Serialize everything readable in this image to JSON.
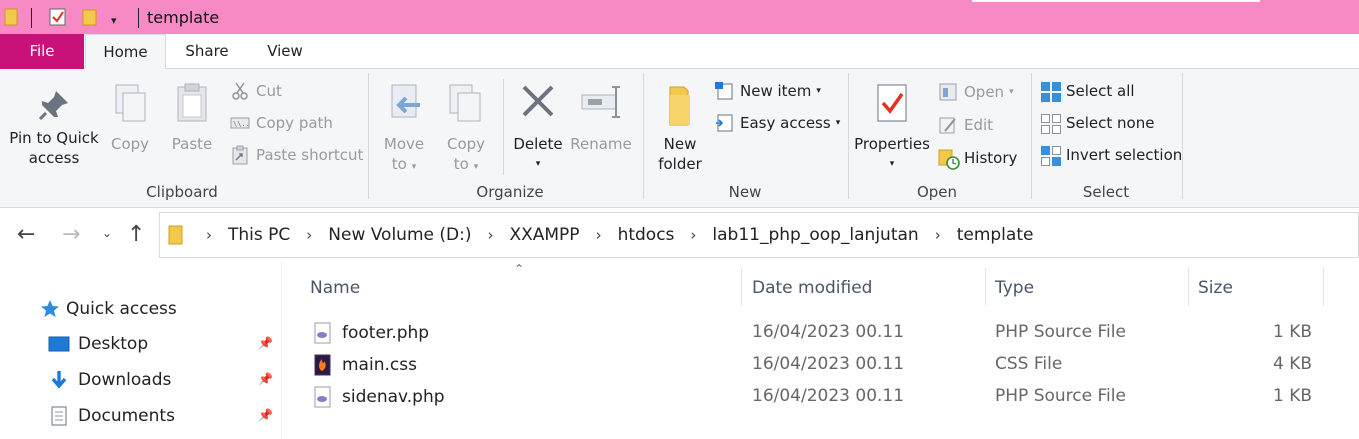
{
  "window": {
    "title": "template"
  },
  "ribbon_tabs": {
    "file": "File",
    "home": "Home",
    "share": "Share",
    "view": "View"
  },
  "clipboard": {
    "pin_line1": "Pin to Quick",
    "pin_line2": "access",
    "copy": "Copy",
    "paste": "Paste",
    "cut": "Cut",
    "copy_path": "Copy path",
    "paste_shortcut": "Paste shortcut",
    "group": "Clipboard"
  },
  "organize": {
    "move_line1": "Move",
    "move_line2": "to",
    "copy_line1": "Copy",
    "copy_line2": "to",
    "delete": "Delete",
    "rename": "Rename",
    "group": "Organize"
  },
  "new": {
    "folder_line1": "New",
    "folder_line2": "folder",
    "new_item": "New item",
    "easy_access": "Easy access",
    "group": "New"
  },
  "open": {
    "properties": "Properties",
    "open": "Open",
    "edit": "Edit",
    "history": "History",
    "group": "Open"
  },
  "select": {
    "select_all": "Select all",
    "select_none": "Select none",
    "invert": "Invert selection",
    "group": "Select"
  },
  "breadcrumb": [
    "This PC",
    "New Volume (D:)",
    "XXAMPP",
    "htdocs",
    "lab11_php_oop_lanjutan",
    "template"
  ],
  "nav": {
    "quick_access": "Quick access",
    "items": [
      {
        "label": "Desktop"
      },
      {
        "label": "Downloads"
      },
      {
        "label": "Documents"
      }
    ]
  },
  "columns": {
    "name": "Name",
    "date": "Date modified",
    "type": "Type",
    "size": "Size"
  },
  "files": [
    {
      "name": "footer.php",
      "date": "16/04/2023 00.11",
      "type": "PHP Source File",
      "size": "1 KB",
      "icon": "php-file-icon"
    },
    {
      "name": "main.css",
      "date": "16/04/2023 00.11",
      "type": "CSS File",
      "size": "4 KB",
      "icon": "css-file-icon"
    },
    {
      "name": "sidenav.php",
      "date": "16/04/2023 00.11",
      "type": "PHP Source File",
      "size": "1 KB",
      "icon": "php-file-icon"
    }
  ],
  "colors": {
    "title_bar": "#f78ac4",
    "file_tab": "#c8127a",
    "accent": "#1e7ad6"
  }
}
